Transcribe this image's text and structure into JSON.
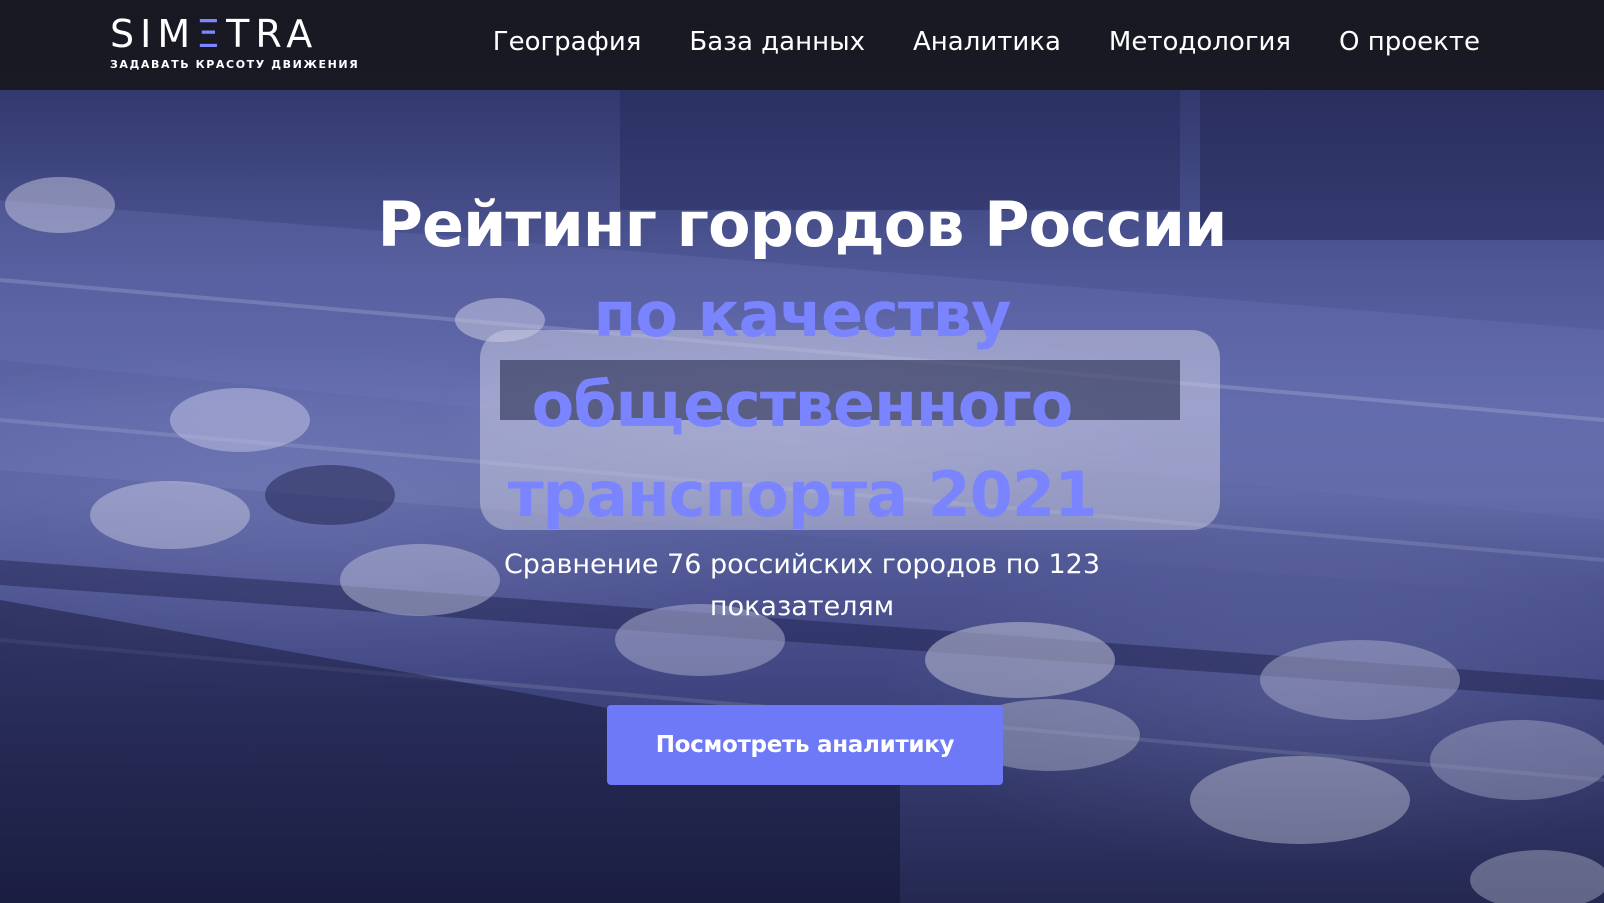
{
  "header": {
    "logo": {
      "word_start": "SIM",
      "word_accent": "Ξ",
      "word_end": "TRA",
      "tagline": "ЗАДАВАТЬ КРАСОТУ ДВИЖЕНИЯ"
    },
    "nav": [
      {
        "label": "География"
      },
      {
        "label": "База данных"
      },
      {
        "label": "Аналитика"
      },
      {
        "label": "Методология"
      },
      {
        "label": "О проекте"
      }
    ]
  },
  "hero": {
    "title_line1": "Рейтинг городов России",
    "title_line2": "по качеству",
    "title_line3": "общественного",
    "title_line4": "транспорта 2021",
    "subtitle": "Сравнение 76 российских городов по 123 показателям",
    "cta_label": "Посмотреть аналитику"
  },
  "colors": {
    "accent": "#7b84ff",
    "button": "#6d79f7",
    "header_bg": "#16161a"
  }
}
